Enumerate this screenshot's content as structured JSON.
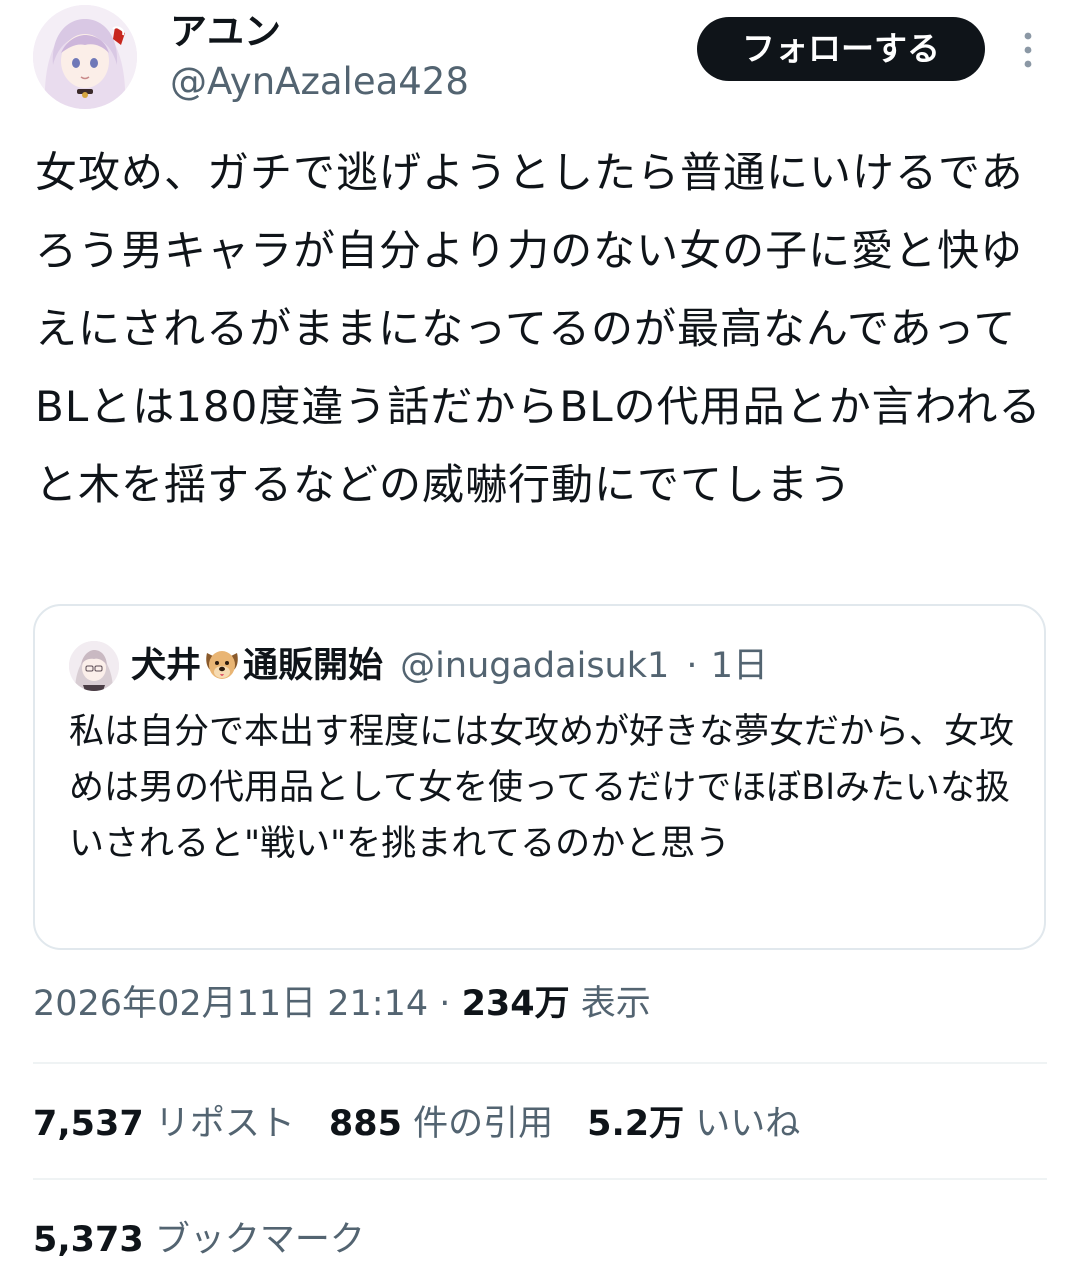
{
  "author": {
    "display_name": "アユン",
    "handle": "@AynAzalea428",
    "avatar_icon": "anime-girl-avatar-icon"
  },
  "actions": {
    "follow_label": "フォローする",
    "more_icon": "more-vertical-icon"
  },
  "tweet": {
    "text": "女攻め、ガチで逃げようとしたら普通にいけるであろう男キャラが自分より力のない女の子に愛と快ゆえにされるがままになってるのが最高なんであってBLとは180度違う話だからBLの代用品とか言われると木を揺するなどの威嚇行動にでてしまう"
  },
  "quote": {
    "name_part1": "犬井",
    "name_emoji": "dog-face-icon",
    "name_part2": "通販開始",
    "handle": "@inugadaisuk1",
    "separator": "·",
    "age": "1日",
    "text": "私は自分で本出す程度には女攻めが好きな夢女だから、女攻めは男の代用品として女を使ってるだけでほぼBlみたいな扱いされると\"戦い\"を挑まれてるのかと思う"
  },
  "meta": {
    "timestamp": "2026年02月11日 21:14",
    "separator": "·",
    "views_count": "234万",
    "views_label": "表示"
  },
  "stats": {
    "reposts_count": "7,537",
    "reposts_label": "リポスト",
    "quotes_count": "885",
    "quotes_label": "件の引用",
    "likes_count": "5.2万",
    "likes_label": "いいね",
    "bookmarks_count": "5,373",
    "bookmarks_label": "ブックマーク"
  },
  "colors": {
    "text_primary": "#0f1419",
    "text_secondary": "#536471",
    "button_bg": "#0f1419",
    "border": "#e1e8ed"
  }
}
